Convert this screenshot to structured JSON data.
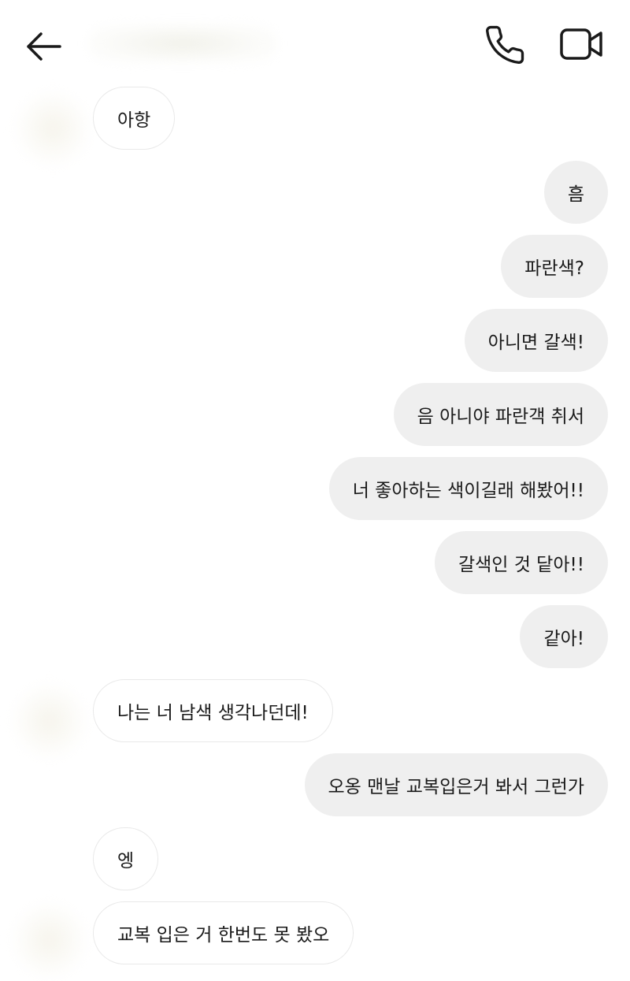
{
  "header": {
    "back_icon": "arrow-left-icon",
    "call_icon": "phone-icon",
    "video_icon": "video-camera-icon"
  },
  "messages": [
    {
      "side": "in",
      "text": "아항"
    },
    {
      "side": "out",
      "text": "흠"
    },
    {
      "side": "out",
      "text": "파란색?"
    },
    {
      "side": "out",
      "text": "아니면 갈색!"
    },
    {
      "side": "out",
      "text": "음 아니야 파란객 취서"
    },
    {
      "side": "out",
      "text": "너 좋아하는 색이길래 해봤어!!"
    },
    {
      "side": "out",
      "text": "갈색인 것 닽아!!"
    },
    {
      "side": "out",
      "text": "같아!"
    },
    {
      "side": "in",
      "text": "나는 너 남색 생각나던데!"
    },
    {
      "side": "out",
      "text": "오옹 맨날 교복입은거 봐서 그런가"
    },
    {
      "side": "in",
      "text": "엥"
    },
    {
      "side": "in",
      "text": "교복 입은 거 한번도 못 봤오"
    }
  ]
}
